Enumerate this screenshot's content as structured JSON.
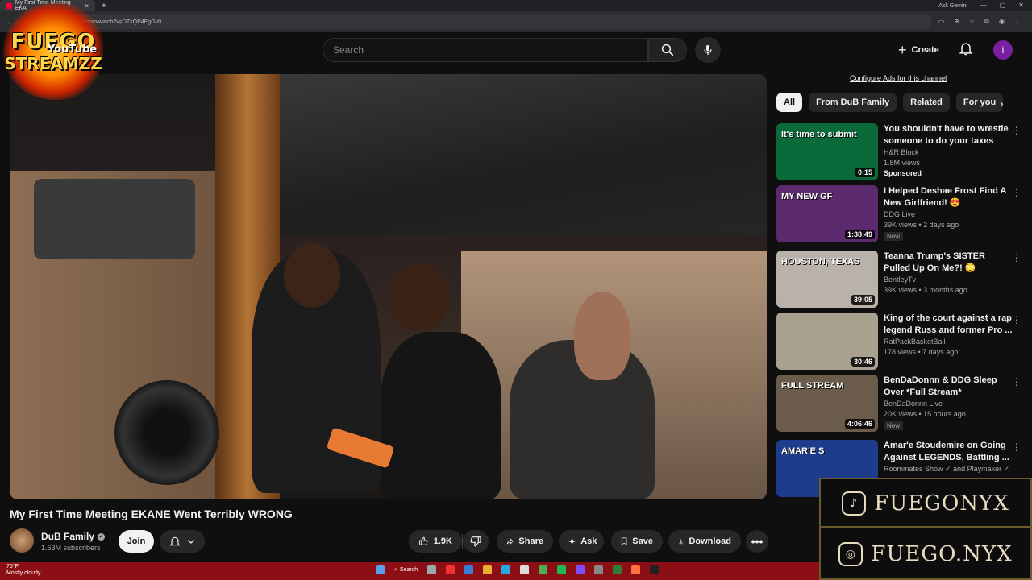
{
  "browser": {
    "tab_title": "My First Time Meeting EKA",
    "url": "youtube.com/watch?v=DTxQP4EgGv0",
    "gemini_label": "Ask Gemini"
  },
  "header": {
    "logo_text_1": "FUEGO",
    "logo_text_2": "STREAMZZ",
    "logo_youtube": "YouTube",
    "search_placeholder": "Search",
    "create_label": "Create",
    "avatar_letter": "i"
  },
  "video": {
    "title": "My First Time Meeting EKANE Went Terribly WRONG",
    "channel": "DuB Family",
    "subscribers": "1.63M subscribers",
    "join_label": "Join",
    "likes": "1.9K",
    "share_label": "Share",
    "ask_label": "Ask",
    "save_label": "Save",
    "download_label": "Download"
  },
  "sidebar": {
    "configure_ads": "Configure Ads for this channel",
    "chips": [
      "All",
      "From DuB Family",
      "Related",
      "For you"
    ],
    "items": [
      {
        "title": "You shouldn't have to wrestle someone to do your taxes",
        "channel": "H&R Block",
        "meta": "1.8M views",
        "badge": "Sponsored",
        "duration": "0:15",
        "thumb_color": "#0b6a3a",
        "thumb_text": "It's time to submit"
      },
      {
        "title": "I Helped Deshae Frost Find A New Girlfriend! 😍",
        "channel": "DDG Live",
        "meta": "39K views • 2 days ago",
        "badge": "New",
        "duration": "1:38:49",
        "thumb_color": "#5c2a6e",
        "thumb_text": "MY NEW GF"
      },
      {
        "title": "Teanna Trump's SISTER Pulled Up On Me?! 😳",
        "channel": "BentleyTv",
        "meta": "39K views • 3 months ago",
        "badge": "",
        "duration": "39:05",
        "thumb_color": "#b9b2aa",
        "thumb_text": "HOUSTON, TEXAS"
      },
      {
        "title": "King of the court against a rap legend Russ and former Pro ...",
        "channel": "RatPackBasketBall",
        "meta": "178 views • 7 days ago",
        "badge": "",
        "duration": "30:46",
        "thumb_color": "#a8a190",
        "thumb_text": ""
      },
      {
        "title": "BenDaDonnn & DDG Sleep Over *Full Stream*",
        "channel": "BenDaDonnn Live",
        "meta": "20K views • 15 hours ago",
        "badge": "New",
        "duration": "4:06:46",
        "thumb_color": "#6b5b4a",
        "thumb_text": "FULL STREAM"
      },
      {
        "title": "Amar'e Stoudemire on Going Against LEGENDS, Battling ...",
        "channel": "Roommates Show ✓ and Playmaker ✓",
        "meta": "",
        "badge": "",
        "duration": "",
        "thumb_color": "#1e3c8c",
        "thumb_text": "AMAR'E S"
      }
    ]
  },
  "overlay": {
    "tiktok": "FUEGONYX",
    "instagram": "FUEGO.NYX"
  },
  "taskbar": {
    "temp": "75°F",
    "weather": "Mostly cloudy",
    "search": "Search"
  },
  "colors": {
    "background": "#0f0f0f",
    "taskbar": "#8b0f14",
    "avatar": "#7b1fa2"
  }
}
